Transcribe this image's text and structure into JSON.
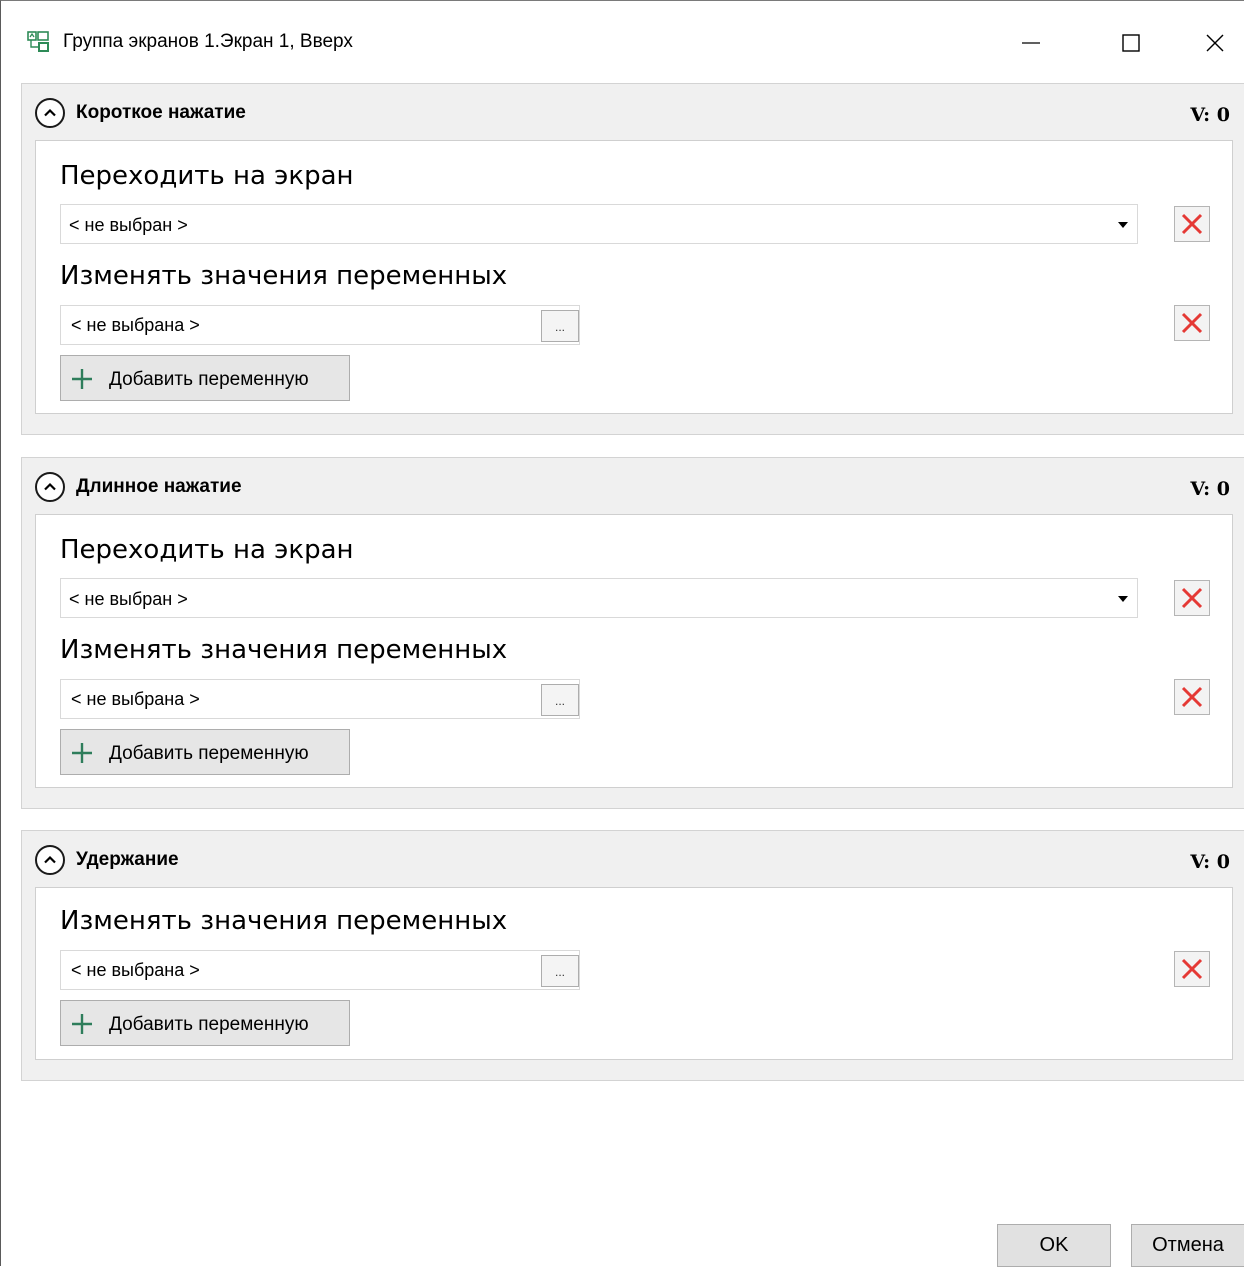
{
  "window": {
    "title": "Группа экранов 1.Экран 1, Вверх",
    "controls": [
      "minimize-icon",
      "maximize-icon",
      "close-icon"
    ]
  },
  "panels": [
    {
      "title": "Короткое нажатие",
      "value_label": "V: 0",
      "screen_label": "Переходить на экран",
      "screen_value": "< не выбран >",
      "vars_label": "Изменять значения переменных",
      "var_value": "< не выбрана >",
      "dots_label": "...",
      "add_label": "Добавить переменную"
    },
    {
      "title": "Длинное нажатие",
      "value_label": "V: 0",
      "screen_label": "Переходить на экран",
      "screen_value": "< не выбран >",
      "vars_label": "Изменять значения переменных",
      "var_value": "< не выбрана >",
      "dots_label": "...",
      "add_label": "Добавить переменную"
    },
    {
      "title": "Удержание",
      "value_label": "V: 0",
      "vars_label": "Изменять значения переменных",
      "var_value": "< не выбрана >",
      "dots_label": "...",
      "add_label": "Добавить переменную"
    }
  ],
  "footer": {
    "ok_label": "OK",
    "cancel_label": "Отмена"
  },
  "colors": {
    "delete_x": "#e53935",
    "add_plus": "#2e7d5b",
    "panel_bg": "#f0f0f0"
  }
}
